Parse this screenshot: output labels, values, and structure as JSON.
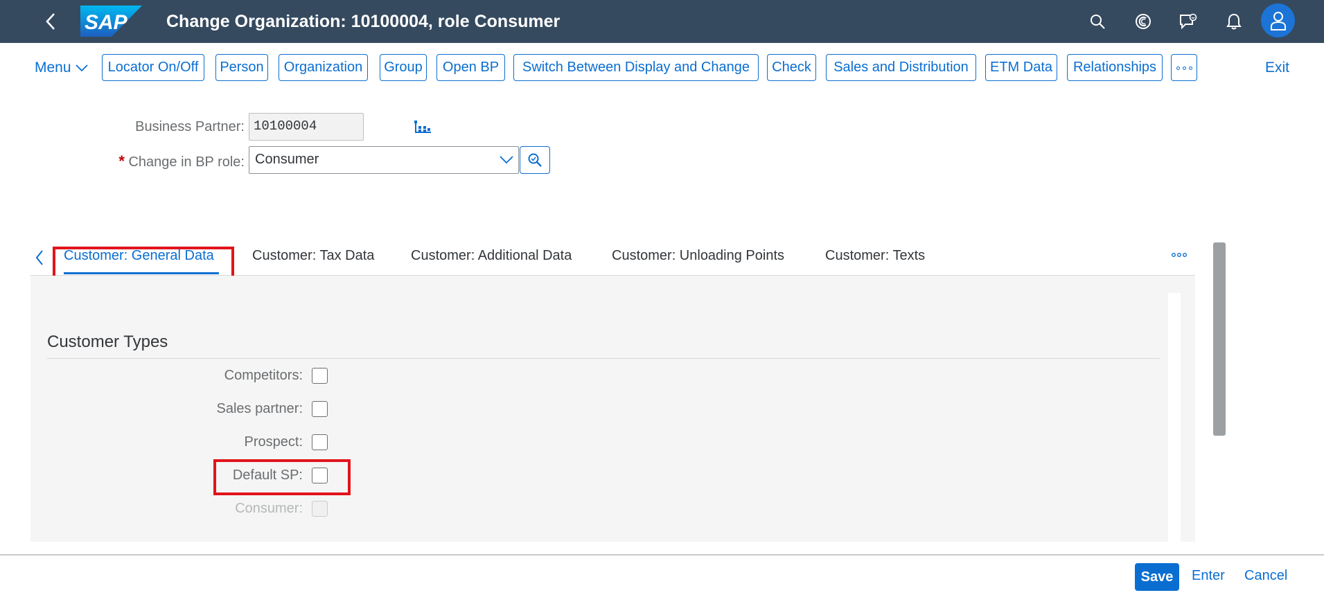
{
  "shell": {
    "title": "Change Organization: 10100004, role Consumer",
    "logo_text": "SAP",
    "icons": [
      "back-icon",
      "search-icon",
      "copilot-icon",
      "feedback-icon",
      "notifications-icon",
      "user-avatar-icon"
    ]
  },
  "toolbar": {
    "menu_label": "Menu",
    "buttons": [
      "Locator On/Off",
      "Person",
      "Organization",
      "Group",
      "Open BP",
      "Switch Between Display and Change",
      "Check",
      "Sales and Distribution",
      "ETM Data",
      "Relationships"
    ],
    "more_label": "∘∘∘",
    "exit_label": "Exit"
  },
  "form": {
    "bp_label": "Business Partner:",
    "bp_value": "10100004",
    "role_required": "*",
    "role_label": "Change in BP role:",
    "role_value": "Consumer"
  },
  "tabs": {
    "items": [
      "Customer: General Data",
      "Customer: Tax Data",
      "Customer: Additional Data",
      "Customer: Unloading Points",
      "Customer: Texts"
    ],
    "active_index": 0,
    "more_label": "∘∘∘"
  },
  "section": {
    "title": "Customer Types",
    "checkboxes": [
      {
        "label": "Competitors:",
        "checked": false,
        "enabled": true
      },
      {
        "label": "Sales partner:",
        "checked": false,
        "enabled": true
      },
      {
        "label": "Prospect:",
        "checked": false,
        "enabled": true
      },
      {
        "label": "Default SP:",
        "checked": false,
        "enabled": true
      },
      {
        "label": "Consumer:",
        "checked": false,
        "enabled": false
      }
    ]
  },
  "footer": {
    "save_label": "Save",
    "enter_label": "Enter",
    "cancel_label": "Cancel"
  },
  "colors": {
    "shell_bg": "#354a5f",
    "accent": "#0a6ed1",
    "highlight": "#e1141b",
    "required": "#bb0000"
  }
}
